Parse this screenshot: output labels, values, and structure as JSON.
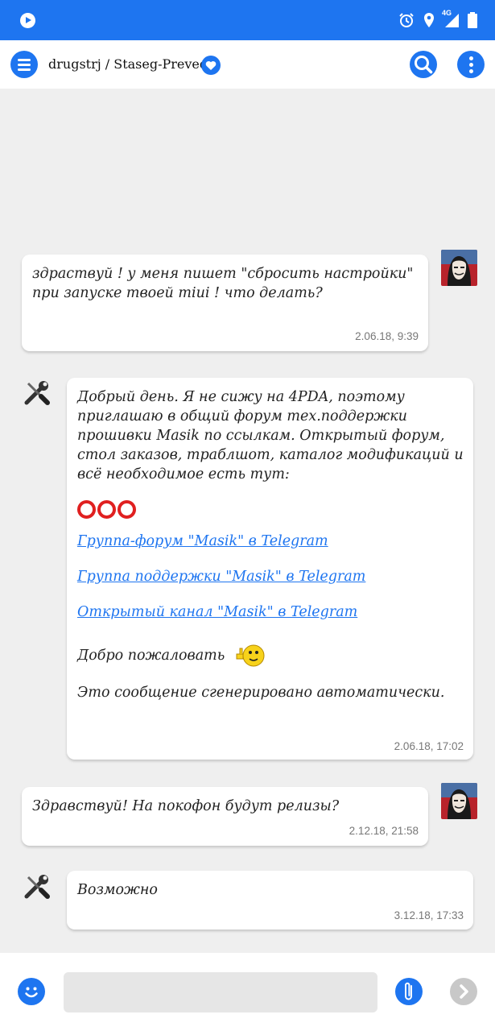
{
  "header": {
    "title": "drugstrj / Staseg-Preved"
  },
  "status_bar": {
    "network": "4G"
  },
  "colors": {
    "accent": "#1e75f0",
    "background": "#efefef",
    "link": "#1e75f0",
    "date_text": "#777777"
  },
  "icons": {
    "menu": "hamburger-icon",
    "favorite": "heart-icon",
    "search": "search-icon",
    "more": "more-vertical-icon",
    "emoji": "smiley-icon",
    "attach": "paperclip-icon",
    "send": "chevron-right-icon"
  },
  "messages": [
    {
      "side": "right",
      "text": "здраствуй ! у меня пишет \"сбросить настройки\" при запуске твоей miui ! что делать?",
      "date": "2.06.18, 9:39"
    },
    {
      "side": "left",
      "text": "Добрый день. Я не сижу на 4PDA, поэтому приглашаю в общий форум тех.поддержки прошивки Masik по ссылкам. Открытый форум, стол заказов, траблшот, каталог модификаций и всё необходимое есть тут:",
      "links": [
        "Группа-форум \"Masik\" в Telegram",
        "Группа поддержки \"Masik\" в Telegram",
        "Открытый канал \"Masik\" в Telegram"
      ],
      "welcome": "Добро пожаловать",
      "auto_note": "Это сообщение сгенерировано автоматически.",
      "date": "2.06.18, 17:02"
    },
    {
      "side": "right",
      "text": "Здравствуй! На покофон будут релизы?",
      "date": "2.12.18, 21:58"
    },
    {
      "side": "left",
      "text": "Возможно",
      "date": "3.12.18, 17:33"
    }
  ],
  "composer": {
    "input_value": "",
    "input_placeholder": ""
  }
}
